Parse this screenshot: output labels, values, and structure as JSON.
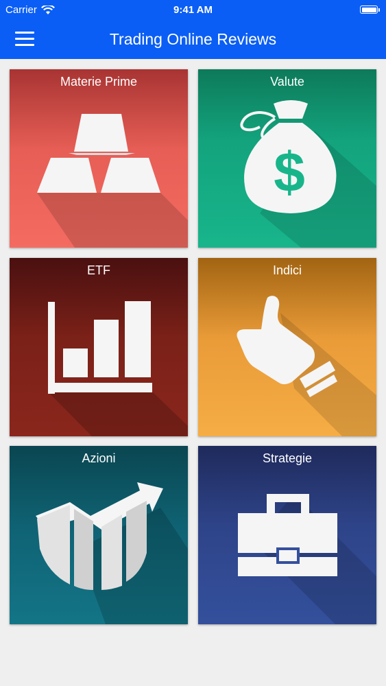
{
  "status_bar": {
    "carrier": "Carrier",
    "time": "9:41 AM"
  },
  "header": {
    "title": "Trading Online Reviews",
    "menu_icon": "hamburger-menu-icon"
  },
  "tiles": [
    {
      "label": "Materie Prime",
      "icon": "gold-bars-icon",
      "color": "#f46b61"
    },
    {
      "label": "Valute",
      "icon": "money-bag-icon",
      "color": "#18b58b"
    },
    {
      "label": "ETF",
      "icon": "bar-chart-icon",
      "color": "#8a261c"
    },
    {
      "label": "Indici",
      "icon": "thumbs-up-icon",
      "color": "#f6ad45"
    },
    {
      "label": "Azioni",
      "icon": "trend-arrow-icon",
      "color": "#137587"
    },
    {
      "label": "Strategie",
      "icon": "briefcase-icon",
      "color": "#34509c"
    }
  ]
}
